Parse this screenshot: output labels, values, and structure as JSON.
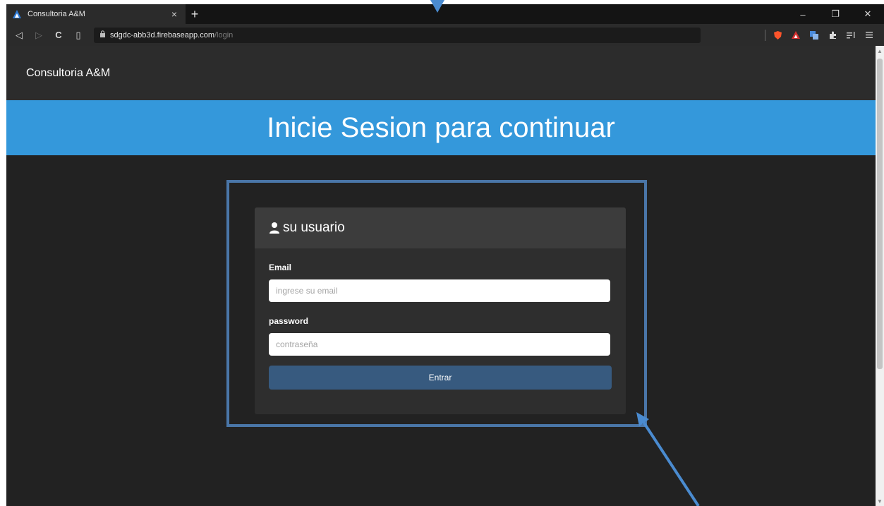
{
  "browser": {
    "tab": {
      "title": "Consultoria A&M",
      "close_glyph": "×"
    },
    "new_tab_glyph": "+",
    "window_controls": {
      "minimize": "–",
      "restore": "❐",
      "close": "✕"
    },
    "toolbar": {
      "back": "◁",
      "forward": "▷",
      "reload": "C",
      "bookmark": "▯",
      "url_host": "sdgdc-abb3d.firebaseapp.com",
      "url_path": "/login",
      "icons": [
        "brave-shield-icon",
        "brave-rewards-icon",
        "translate-icon",
        "extensions-icon",
        "playlist-icon",
        "menu-icon"
      ]
    }
  },
  "page": {
    "navbar": {
      "brand": "Consultoria A&M"
    },
    "hero": {
      "title": "Inicie Sesion para continuar"
    },
    "login_card": {
      "header": "su usuario",
      "email": {
        "label": "Email",
        "placeholder": "ingrese su email"
      },
      "password": {
        "label": "password",
        "placeholder": "contraseña"
      },
      "submit_label": "Entrar"
    }
  },
  "colors": {
    "hero_bg": "#3498db",
    "button_bg": "#375a7f",
    "annotation": "#4a76a8"
  }
}
